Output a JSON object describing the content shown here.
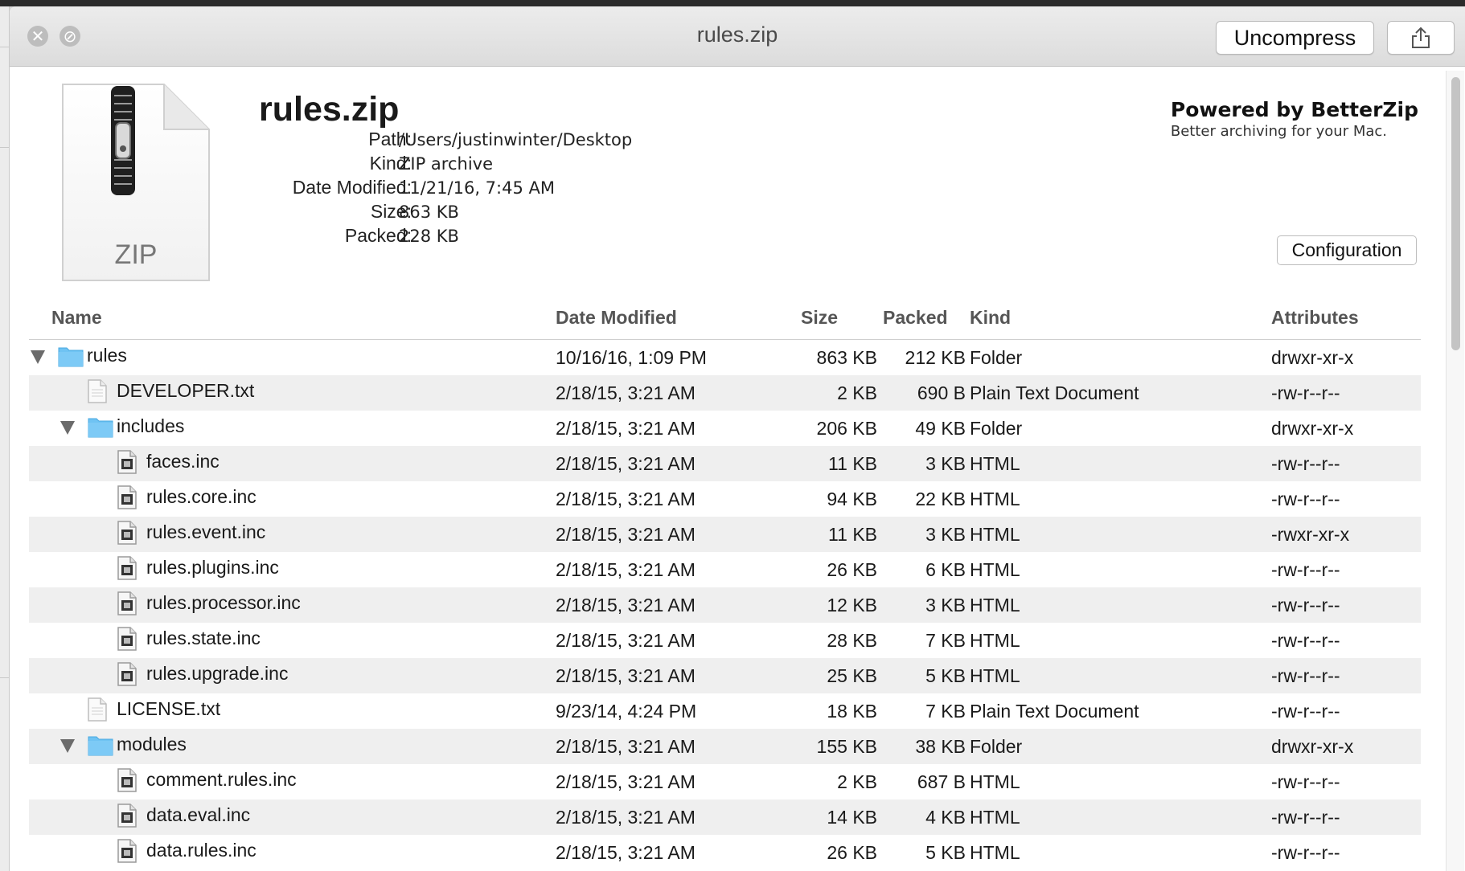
{
  "window": {
    "title": "rules.zip",
    "buttons": {
      "uncompress": "Uncompress"
    }
  },
  "archive": {
    "name": "rules.zip",
    "icon_label": "ZIP",
    "info": [
      {
        "label": "Path:",
        "value": "/Users/justinwinter/Desktop"
      },
      {
        "label": "Kind:",
        "value": "ZIP archive"
      },
      {
        "label": "Date Modified:",
        "value": "11/21/16, 7:45 AM"
      },
      {
        "label": "Size:",
        "value": "863 KB"
      },
      {
        "label": "Packed:",
        "value": "228 KB"
      }
    ]
  },
  "branding": {
    "title": "Powered by BetterZip",
    "subtitle": "Better archiving for your Mac."
  },
  "config_button": "Configuration",
  "table": {
    "columns": {
      "name": "Name",
      "date": "Date Modified",
      "size": "Size",
      "packed": "Packed",
      "kind": "Kind",
      "attributes": "Attributes"
    },
    "rows": [
      {
        "name": "rules",
        "date": "10/16/16, 1:09 PM",
        "size": "863 KB",
        "packed": "212 KB",
        "kind": "Folder",
        "attributes": "drwxr-xr-x"
      },
      {
        "name": "DEVELOPER.txt",
        "date": "2/18/15, 3:21 AM",
        "size": "2 KB",
        "packed": "690 B",
        "kind": "Plain Text Document",
        "attributes": "-rw-r--r--"
      },
      {
        "name": "includes",
        "date": "2/18/15, 3:21 AM",
        "size": "206 KB",
        "packed": "49 KB",
        "kind": "Folder",
        "attributes": "drwxr-xr-x"
      },
      {
        "name": "faces.inc",
        "date": "2/18/15, 3:21 AM",
        "size": "11 KB",
        "packed": "3 KB",
        "kind": "HTML",
        "attributes": "-rw-r--r--"
      },
      {
        "name": "rules.core.inc",
        "date": "2/18/15, 3:21 AM",
        "size": "94 KB",
        "packed": "22 KB",
        "kind": "HTML",
        "attributes": "-rw-r--r--"
      },
      {
        "name": "rules.event.inc",
        "date": "2/18/15, 3:21 AM",
        "size": "11 KB",
        "packed": "3 KB",
        "kind": "HTML",
        "attributes": "-rwxr-xr-x"
      },
      {
        "name": "rules.plugins.inc",
        "date": "2/18/15, 3:21 AM",
        "size": "26 KB",
        "packed": "6 KB",
        "kind": "HTML",
        "attributes": "-rw-r--r--"
      },
      {
        "name": "rules.processor.inc",
        "date": "2/18/15, 3:21 AM",
        "size": "12 KB",
        "packed": "3 KB",
        "kind": "HTML",
        "attributes": "-rw-r--r--"
      },
      {
        "name": "rules.state.inc",
        "date": "2/18/15, 3:21 AM",
        "size": "28 KB",
        "packed": "7 KB",
        "kind": "HTML",
        "attributes": "-rw-r--r--"
      },
      {
        "name": "rules.upgrade.inc",
        "date": "2/18/15, 3:21 AM",
        "size": "25 KB",
        "packed": "5 KB",
        "kind": "HTML",
        "attributes": "-rw-r--r--"
      },
      {
        "name": "LICENSE.txt",
        "date": "9/23/14, 4:24 PM",
        "size": "18 KB",
        "packed": "7 KB",
        "kind": "Plain Text Document",
        "attributes": "-rw-r--r--"
      },
      {
        "name": "modules",
        "date": "2/18/15, 3:21 AM",
        "size": "155 KB",
        "packed": "38 KB",
        "kind": "Folder",
        "attributes": "drwxr-xr-x"
      },
      {
        "name": "comment.rules.inc",
        "date": "2/18/15, 3:21 AM",
        "size": "2 KB",
        "packed": "687 B",
        "kind": "HTML",
        "attributes": "-rw-r--r--"
      },
      {
        "name": "data.eval.inc",
        "date": "2/18/15, 3:21 AM",
        "size": "14 KB",
        "packed": "4 KB",
        "kind": "HTML",
        "attributes": "-rw-r--r--"
      },
      {
        "name": "data.rules.inc",
        "date": "2/18/15, 3:21 AM",
        "size": "26 KB",
        "packed": "5 KB",
        "kind": "HTML",
        "attributes": "-rw-r--r--"
      }
    ]
  }
}
